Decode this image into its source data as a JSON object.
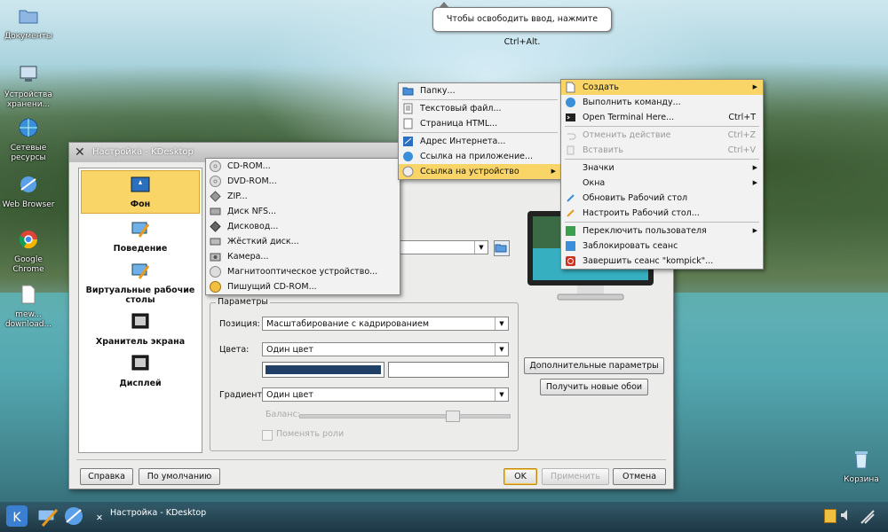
{
  "tooltip": {
    "text": "Чтобы освободить ввод, нажмите Ctrl+Alt."
  },
  "desktop_icons": [
    {
      "label": "Документы",
      "icon": "folder-icon"
    },
    {
      "label": "Устройства хранени...",
      "icon": "computer-icon"
    },
    {
      "label": "Сетевые ресурсы",
      "icon": "network-globe-icon"
    },
    {
      "label": "Web Browser",
      "icon": "browser-icon"
    },
    {
      "label": "Google Chrome",
      "icon": "chrome-icon"
    },
    {
      "label": "mew... download...",
      "icon": "file-icon"
    },
    {
      "label": "Корзина",
      "icon": "trash-icon"
    }
  ],
  "dialog": {
    "title": "Настройка - KDesktop",
    "sidebar": [
      {
        "label": "Фон",
        "selected": true
      },
      {
        "label": "Поведение"
      },
      {
        "label": "Виртуальные рабочие столы"
      },
      {
        "label": "Хранитель экрана"
      },
      {
        "label": "Дисплей"
      }
    ],
    "params": {
      "title": "Параметры",
      "position_label": "Позиция:",
      "position_value": "Масштабирование с кадрированием",
      "colors_label": "Цвета:",
      "colors_value": "Один цвет",
      "color1": "#1f3f66",
      "gradient_label": "Градиент:",
      "gradient_value": "Один цвет",
      "balance_label": "Баланс:",
      "swap_label": "Поменять роли"
    },
    "buttons": {
      "advanced": "Дополнительные параметры",
      "get_new": "Получить новые обои",
      "help": "Справка",
      "defaults": "По умолчанию",
      "ok": "OK",
      "apply": "Применить",
      "cancel": "Отмена"
    }
  },
  "device_menu": [
    {
      "label": "CD-ROM..."
    },
    {
      "label": "DVD-ROM..."
    },
    {
      "label": "ZIP..."
    },
    {
      "label": "Диск NFS..."
    },
    {
      "label": "Дисковод..."
    },
    {
      "label": "Жёсткий диск..."
    },
    {
      "label": "Камера..."
    },
    {
      "label": "Магнитооптическое устройство..."
    },
    {
      "label": "Пишущий CD-ROM..."
    }
  ],
  "create_menu": [
    {
      "label": "Папку..."
    },
    {
      "label": "Текстовый файл..."
    },
    {
      "label": "Страница HTML..."
    },
    {
      "label": "Адрес Интернета..."
    },
    {
      "label": "Ссылка на приложение..."
    },
    {
      "label": "Ссылка на устройство",
      "highlighted": true
    }
  ],
  "context_menu": [
    {
      "label": "Создать",
      "highlighted": true,
      "submenu": true
    },
    {
      "label": "Выполнить команду..."
    },
    {
      "label": "Open Terminal Here...",
      "shortcut": "Ctrl+T"
    },
    {
      "label": "Отменить действие",
      "shortcut": "Ctrl+Z",
      "disabled": true
    },
    {
      "label": "Вставить",
      "shortcut": "Ctrl+V",
      "disabled": true
    },
    {
      "label": "Значки",
      "submenu": true
    },
    {
      "label": "Окна",
      "submenu": true
    },
    {
      "label": "Обновить Рабочий стол"
    },
    {
      "label": "Настроить Рабочий стол..."
    },
    {
      "label": "Переключить пользователя",
      "submenu": true
    },
    {
      "label": "Заблокировать сеанс"
    },
    {
      "label": "Завершить сеанс \"kompick\"..."
    }
  ],
  "taskbar": {
    "task_title": "Настройка - KDesktop"
  }
}
